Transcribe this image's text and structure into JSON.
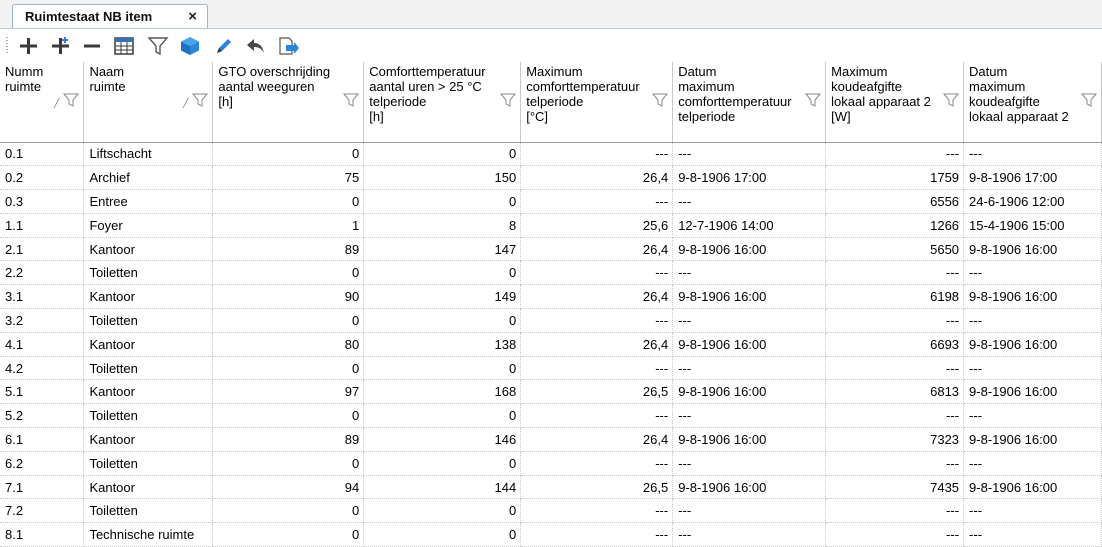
{
  "tab": {
    "title": "Ruimtestaat NB item",
    "close": "×"
  },
  "toolbar": {
    "buttons": [
      {
        "name": "add-icon"
      },
      {
        "name": "add-multiple-icon"
      },
      {
        "name": "remove-icon"
      },
      {
        "name": "table-icon"
      },
      {
        "name": "filter-icon"
      },
      {
        "name": "cube-icon"
      },
      {
        "name": "edit-pencil-icon"
      },
      {
        "name": "undo-icon"
      },
      {
        "name": "export-icon"
      }
    ]
  },
  "grid": {
    "columns": [
      {
        "label": "Numm\nruimte",
        "align": "txt",
        "sort": true
      },
      {
        "label": "Naam\nruimte",
        "align": "txt",
        "sort": true
      },
      {
        "label": "GTO overschrijding\naantal weeguren\n[h]",
        "align": "num"
      },
      {
        "label": "Comforttemperatuur\naantal uren > 25 °C\ntelperiode\n[h]",
        "align": "num"
      },
      {
        "label": "Maximum\ncomforttemperatuur\ntelperiode\n[°C]",
        "align": "num"
      },
      {
        "label": "Datum\nmaximum\ncomforttemperatuur\ntelperiode",
        "align": "txt"
      },
      {
        "label": "Maximum\nkoudeafgifte\nlokaal apparaat 2\n[W]",
        "align": "num"
      },
      {
        "label": "Datum\nmaximum\nkoudeafgifte\nlokaal apparaat 2",
        "align": "txt"
      }
    ],
    "rows": [
      [
        "0.1",
        "Liftschacht",
        "0",
        "0",
        "---",
        "---",
        "---",
        "---"
      ],
      [
        "0.2",
        "Archief",
        "75",
        "150",
        "26,4",
        "9-8-1906 17:00",
        "1759",
        "9-8-1906 17:00"
      ],
      [
        "0.3",
        "Entree",
        "0",
        "0",
        "---",
        "---",
        "6556",
        "24-6-1906 12:00"
      ],
      [
        "1.1",
        "Foyer",
        "1",
        "8",
        "25,6",
        "12-7-1906 14:00",
        "1266",
        "15-4-1906 15:00"
      ],
      [
        "2.1",
        "Kantoor",
        "89",
        "147",
        "26,4",
        "9-8-1906 16:00",
        "5650",
        "9-8-1906 16:00"
      ],
      [
        "2.2",
        "Toiletten",
        "0",
        "0",
        "---",
        "---",
        "---",
        "---"
      ],
      [
        "3.1",
        "Kantoor",
        "90",
        "149",
        "26,4",
        "9-8-1906 16:00",
        "6198",
        "9-8-1906 16:00"
      ],
      [
        "3.2",
        "Toiletten",
        "0",
        "0",
        "---",
        "---",
        "---",
        "---"
      ],
      [
        "4.1",
        "Kantoor",
        "80",
        "138",
        "26,4",
        "9-8-1906 16:00",
        "6693",
        "9-8-1906 16:00"
      ],
      [
        "4.2",
        "Toiletten",
        "0",
        "0",
        "---",
        "---",
        "---",
        "---"
      ],
      [
        "5.1",
        "Kantoor",
        "97",
        "168",
        "26,5",
        "9-8-1906 16:00",
        "6813",
        "9-8-1906 16:00"
      ],
      [
        "5.2",
        "Toiletten",
        "0",
        "0",
        "---",
        "---",
        "---",
        "---"
      ],
      [
        "6.1",
        "Kantoor",
        "89",
        "146",
        "26,4",
        "9-8-1906 16:00",
        "7323",
        "9-8-1906 16:00"
      ],
      [
        "6.2",
        "Toiletten",
        "0",
        "0",
        "---",
        "---",
        "---",
        "---"
      ],
      [
        "7.1",
        "Kantoor",
        "94",
        "144",
        "26,5",
        "9-8-1906 16:00",
        "7435",
        "9-8-1906 16:00"
      ],
      [
        "7.2",
        "Toiletten",
        "0",
        "0",
        "---",
        "---",
        "---",
        "---"
      ],
      [
        "8.1",
        "Technische ruimte",
        "0",
        "0",
        "---",
        "---",
        "---",
        "---"
      ]
    ]
  }
}
